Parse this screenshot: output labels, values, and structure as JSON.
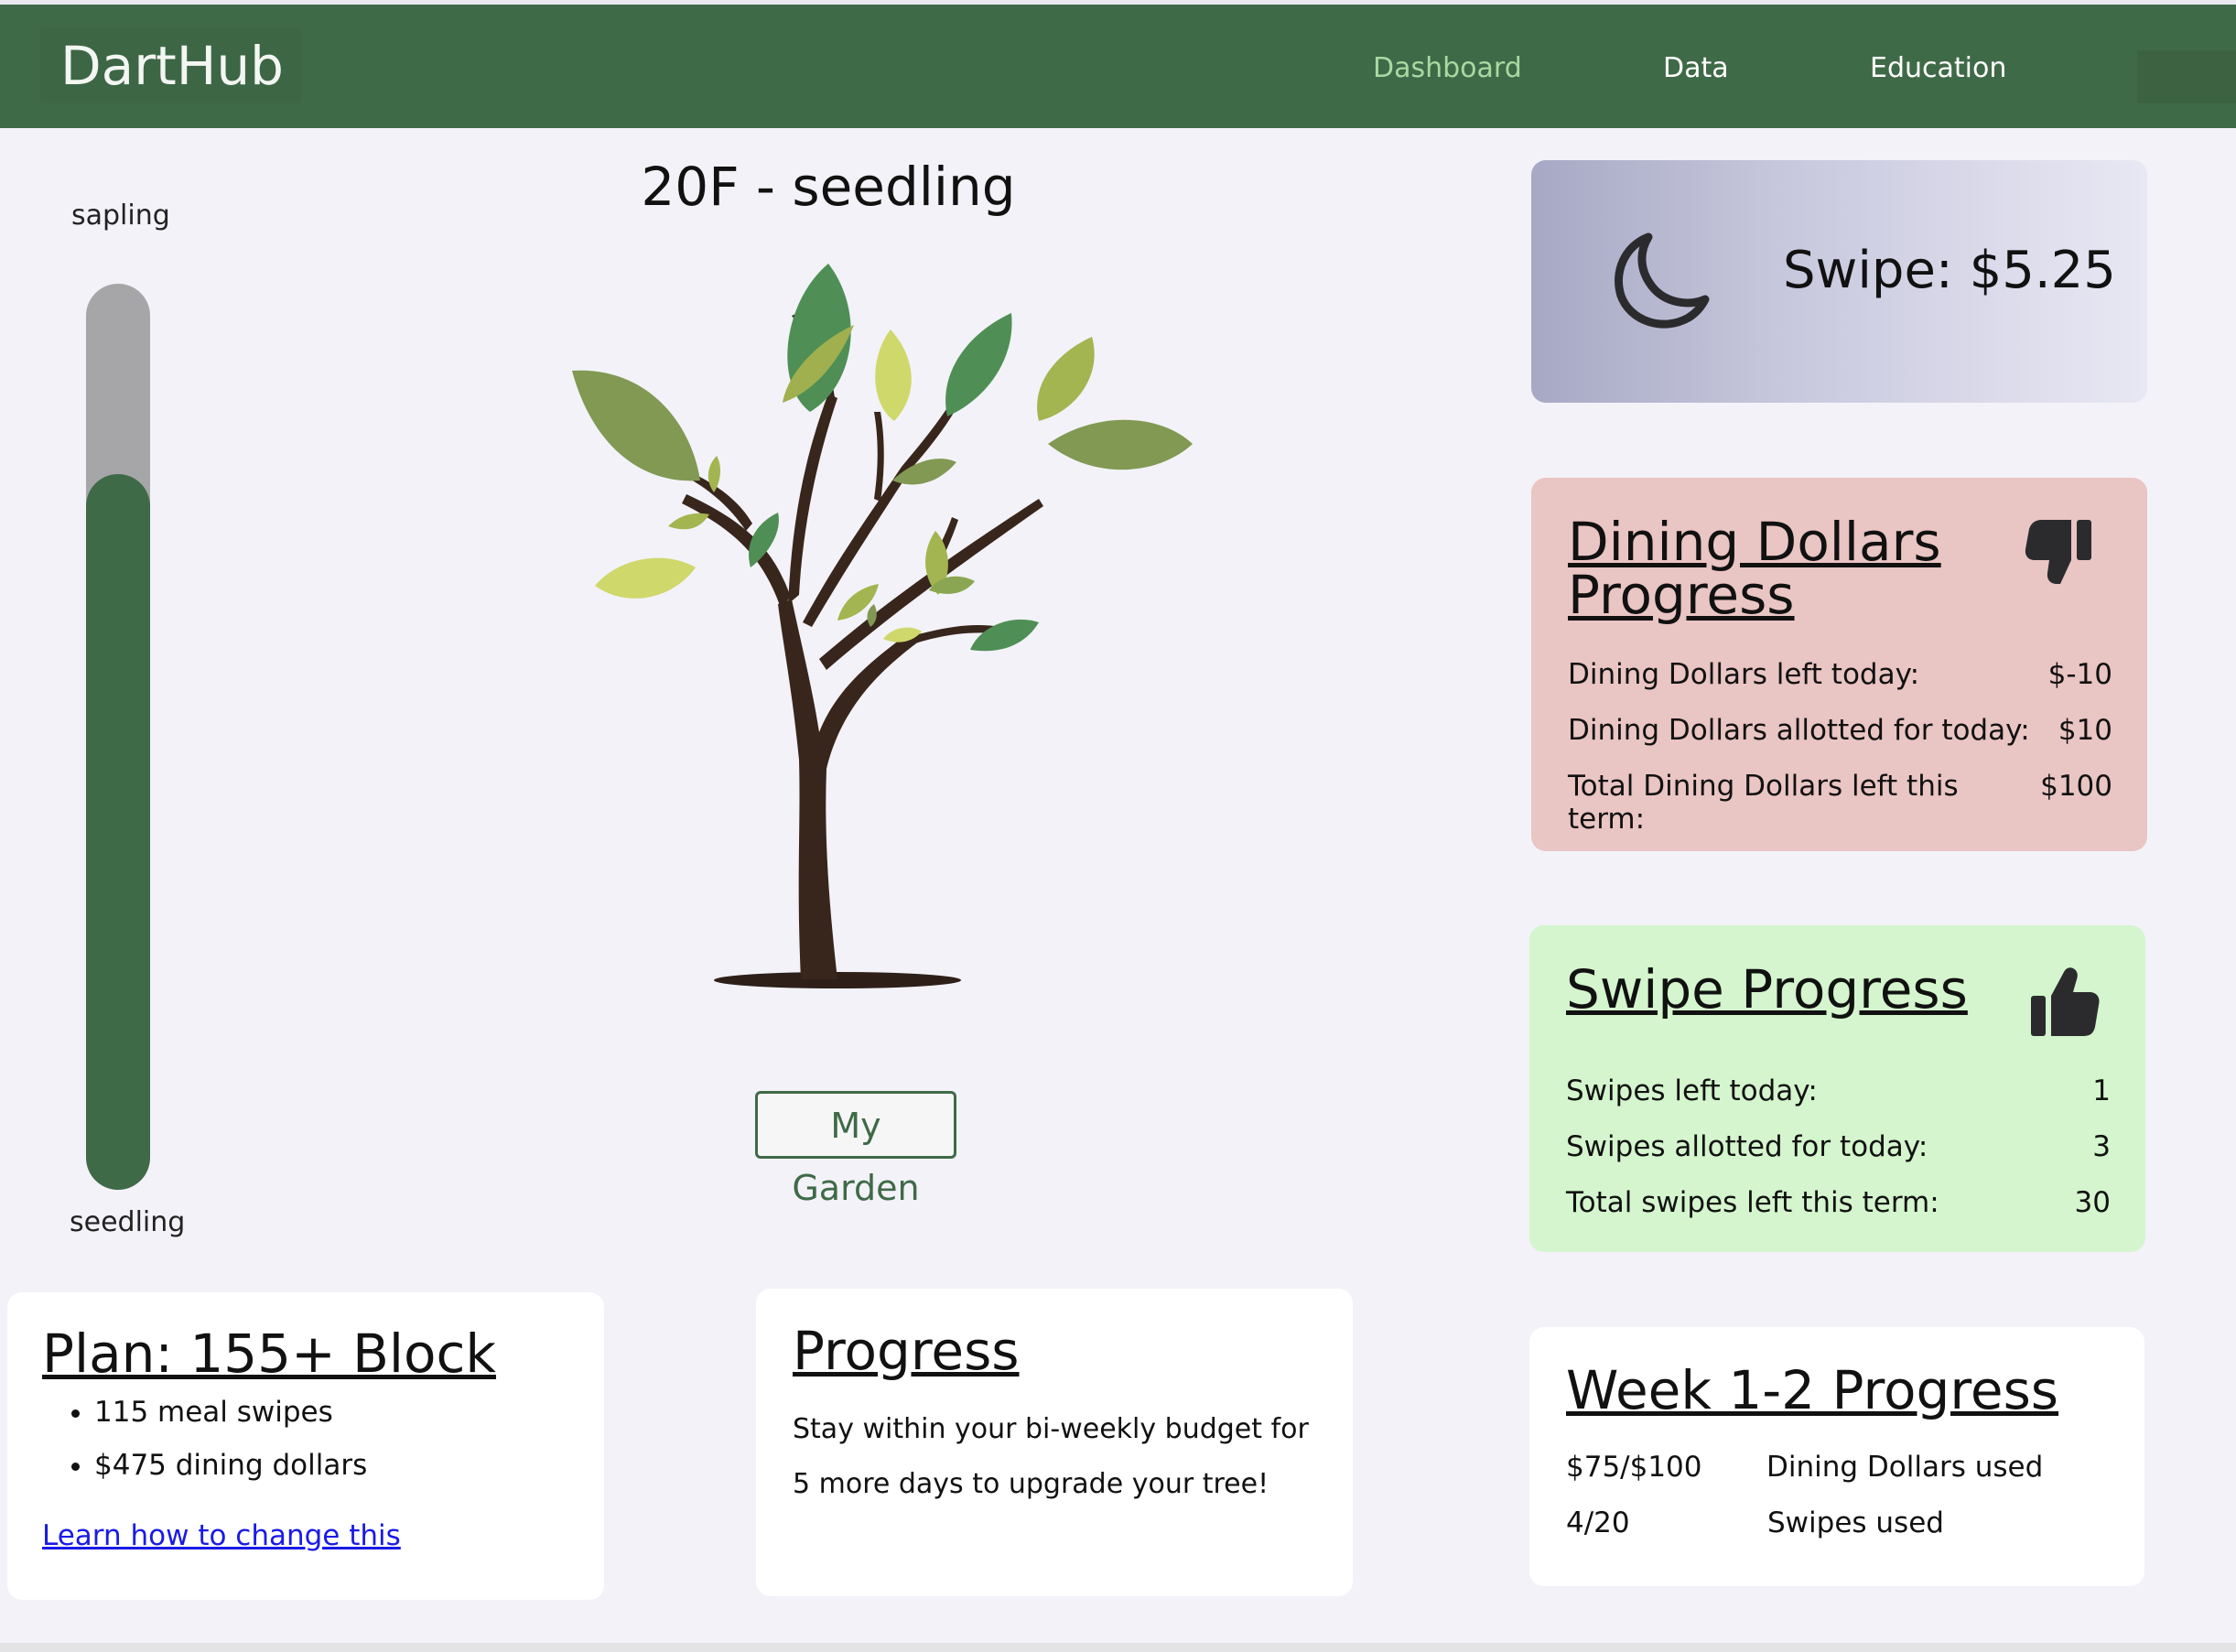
{
  "nav": {
    "brand": "DartHub",
    "links": [
      {
        "label": "Dashboard",
        "active": true
      },
      {
        "label": "Data",
        "active": false
      },
      {
        "label": "Education",
        "active": false
      }
    ],
    "colors": {
      "bar": "#3f6a47",
      "active_link": "#a8d9a1"
    }
  },
  "meter": {
    "top_label": "sapling",
    "bottom_label": "seedling",
    "fill_fraction": 0.79,
    "colors": {
      "fill": "#3f6a47",
      "track": "#a6a6a9"
    }
  },
  "tree": {
    "title": "20F - seedling",
    "garden_button": "My Garden"
  },
  "swipe_card": {
    "icon": "moon-icon",
    "text": "Swipe: $5.25"
  },
  "dining_card": {
    "title_line1": "Dining Dollars",
    "title_line2": "Progress",
    "icon": "thumbs-down-icon",
    "rows": [
      {
        "label": "Dining Dollars left today:",
        "value": "$-10"
      },
      {
        "label": "Dining Dollars allotted for today:",
        "value": "$10"
      },
      {
        "label": "Total Dining Dollars left this term:",
        "value": "$100"
      }
    ],
    "color": "#e9c5c3"
  },
  "swipe_progress_card": {
    "title": "Swipe Progress",
    "icon": "thumbs-up-icon",
    "rows": [
      {
        "label": "Swipes left today:",
        "value": "1"
      },
      {
        "label": "Swipes allotted for today:",
        "value": "3"
      },
      {
        "label": "Total swipes left this term:",
        "value": "30"
      }
    ],
    "color": "#d4f5cd"
  },
  "plan_card": {
    "title": "Plan: 155+ Block",
    "items": [
      "115 meal swipes",
      "$475 dining dollars"
    ],
    "link": "Learn how to change this"
  },
  "progress_card": {
    "title": "Progress",
    "text": "Stay within your bi-weekly budget for 5 more days to upgrade your tree!"
  },
  "week_card": {
    "title": "Week 1-2 Progress",
    "rows": [
      {
        "value": "$75/$100",
        "label": "Dining Dollars used"
      },
      {
        "value": "4/20",
        "label": "Swipes used"
      }
    ]
  }
}
